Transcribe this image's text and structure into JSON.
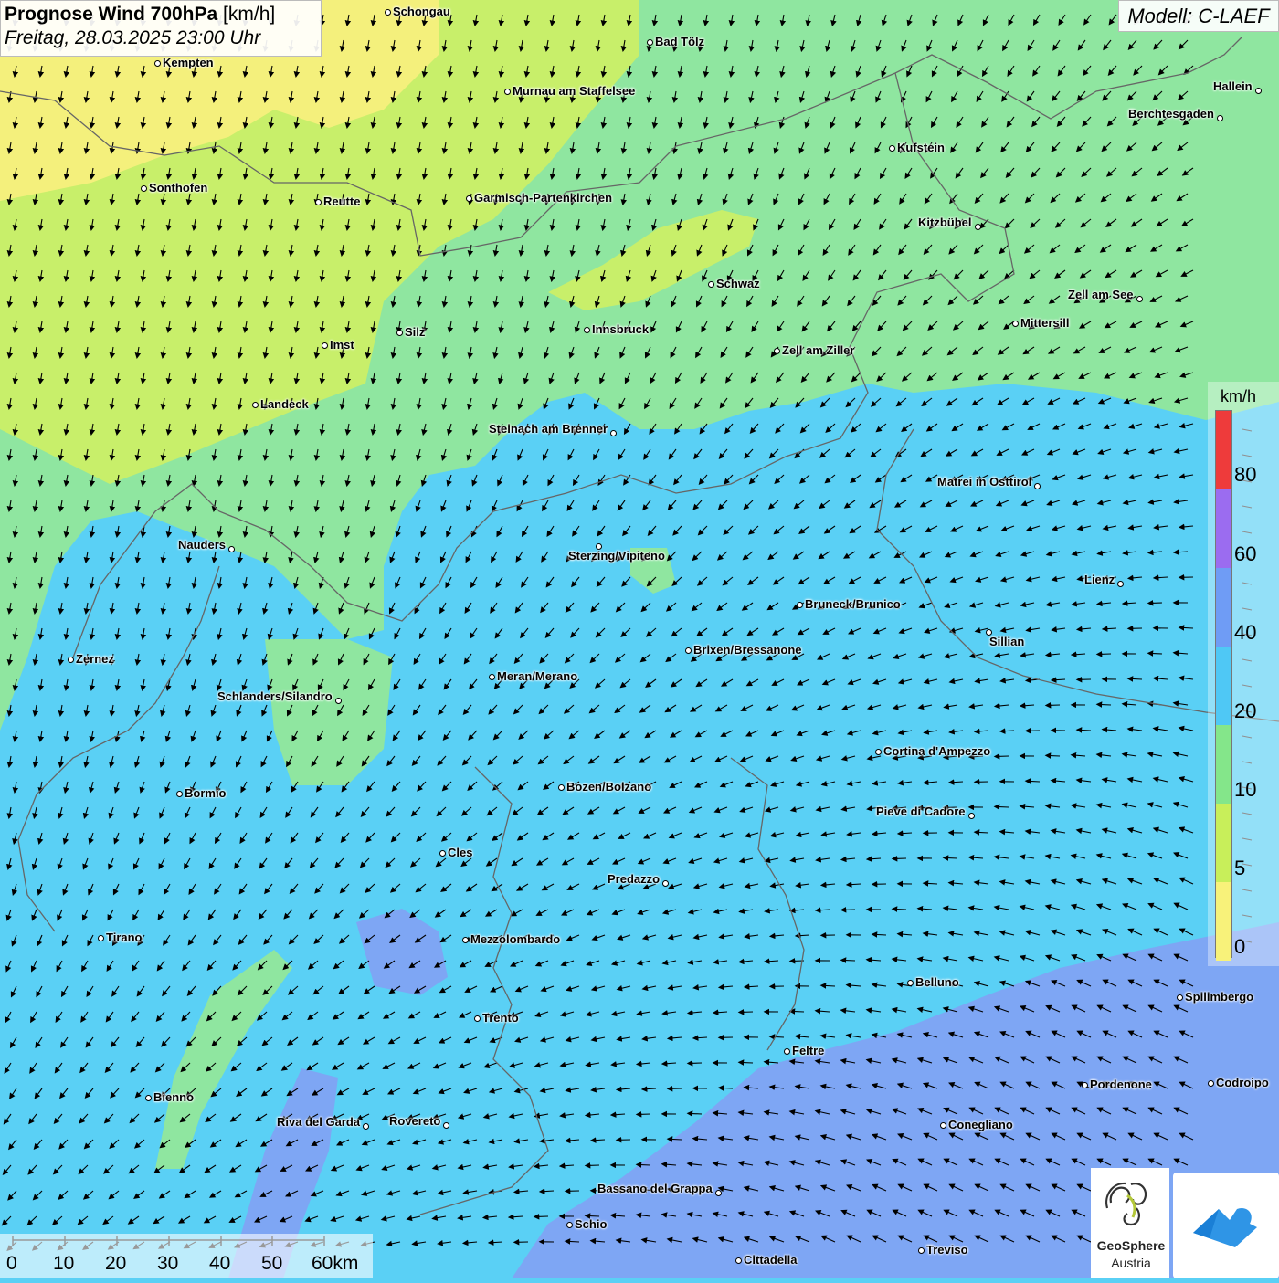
{
  "title": {
    "main": "Prognose Wind 700hPa",
    "unit": "[km/h]",
    "datetime": "Freitag, 28.03.2025 23:00 Uhr"
  },
  "model": "Modell: C-LAEF",
  "legend": {
    "unit": "km/h",
    "labels": [
      "80",
      "60",
      "40",
      "20",
      "10",
      "5",
      "0"
    ],
    "colors": [
      "#ee3b3b",
      "#9b6cf0",
      "#6f9cf5",
      "#4fc8f5",
      "#84e68a",
      "#c8ef5a",
      "#f8f27a"
    ]
  },
  "scale": {
    "labels": [
      "0",
      "10",
      "20",
      "30",
      "40",
      "50",
      "60km"
    ]
  },
  "logo": {
    "line1": "GeoSphere",
    "line2": "Austria"
  },
  "cities": [
    {
      "name": "Schongau"
    },
    {
      "name": "Bad Tölz"
    },
    {
      "name": "Kempten"
    },
    {
      "name": "Hallein"
    },
    {
      "name": "Murnau am Staffelsee"
    },
    {
      "name": "Berchtesgaden"
    },
    {
      "name": "Kufstein"
    },
    {
      "name": "Sonthofen"
    },
    {
      "name": "Reutte"
    },
    {
      "name": "Garmisch-Partenkirchen"
    },
    {
      "name": "Kitzbühel"
    },
    {
      "name": "Schwaz"
    },
    {
      "name": "Zell am See"
    },
    {
      "name": "Mittersill"
    },
    {
      "name": "Innsbruck"
    },
    {
      "name": "Silz"
    },
    {
      "name": "Imst"
    },
    {
      "name": "Zell am Ziller"
    },
    {
      "name": "Landeck"
    },
    {
      "name": "Steinach am Brenner"
    },
    {
      "name": "Matrei in Osttirol"
    },
    {
      "name": "Nauders"
    },
    {
      "name": "Sterzing/Vipiteno"
    },
    {
      "name": "Lienz"
    },
    {
      "name": "Bruneck/Brunico"
    },
    {
      "name": "Sillian"
    },
    {
      "name": "Zernez"
    },
    {
      "name": "Brixen/Bressanone"
    },
    {
      "name": "Meran/Merano"
    },
    {
      "name": "Schlanders/Silandro"
    },
    {
      "name": "Cortina d'Ampezzo"
    },
    {
      "name": "Bozen/Bolzano"
    },
    {
      "name": "Bormio"
    },
    {
      "name": "Pieve di Cadore"
    },
    {
      "name": "Cles"
    },
    {
      "name": "Predazzo"
    },
    {
      "name": "Tirano"
    },
    {
      "name": "Mezzolombardo"
    },
    {
      "name": "Belluno"
    },
    {
      "name": "Spilimbergo"
    },
    {
      "name": "Trento"
    },
    {
      "name": "Feltre"
    },
    {
      "name": "Bienno"
    },
    {
      "name": "Pordenone"
    },
    {
      "name": "Codroipo"
    },
    {
      "name": "Riva del Garda"
    },
    {
      "name": "Rovereto"
    },
    {
      "name": "Conegliano"
    },
    {
      "name": "Bassano del Grappa"
    },
    {
      "name": "Schio"
    },
    {
      "name": "Treviso"
    },
    {
      "name": "Cittadella"
    }
  ]
}
